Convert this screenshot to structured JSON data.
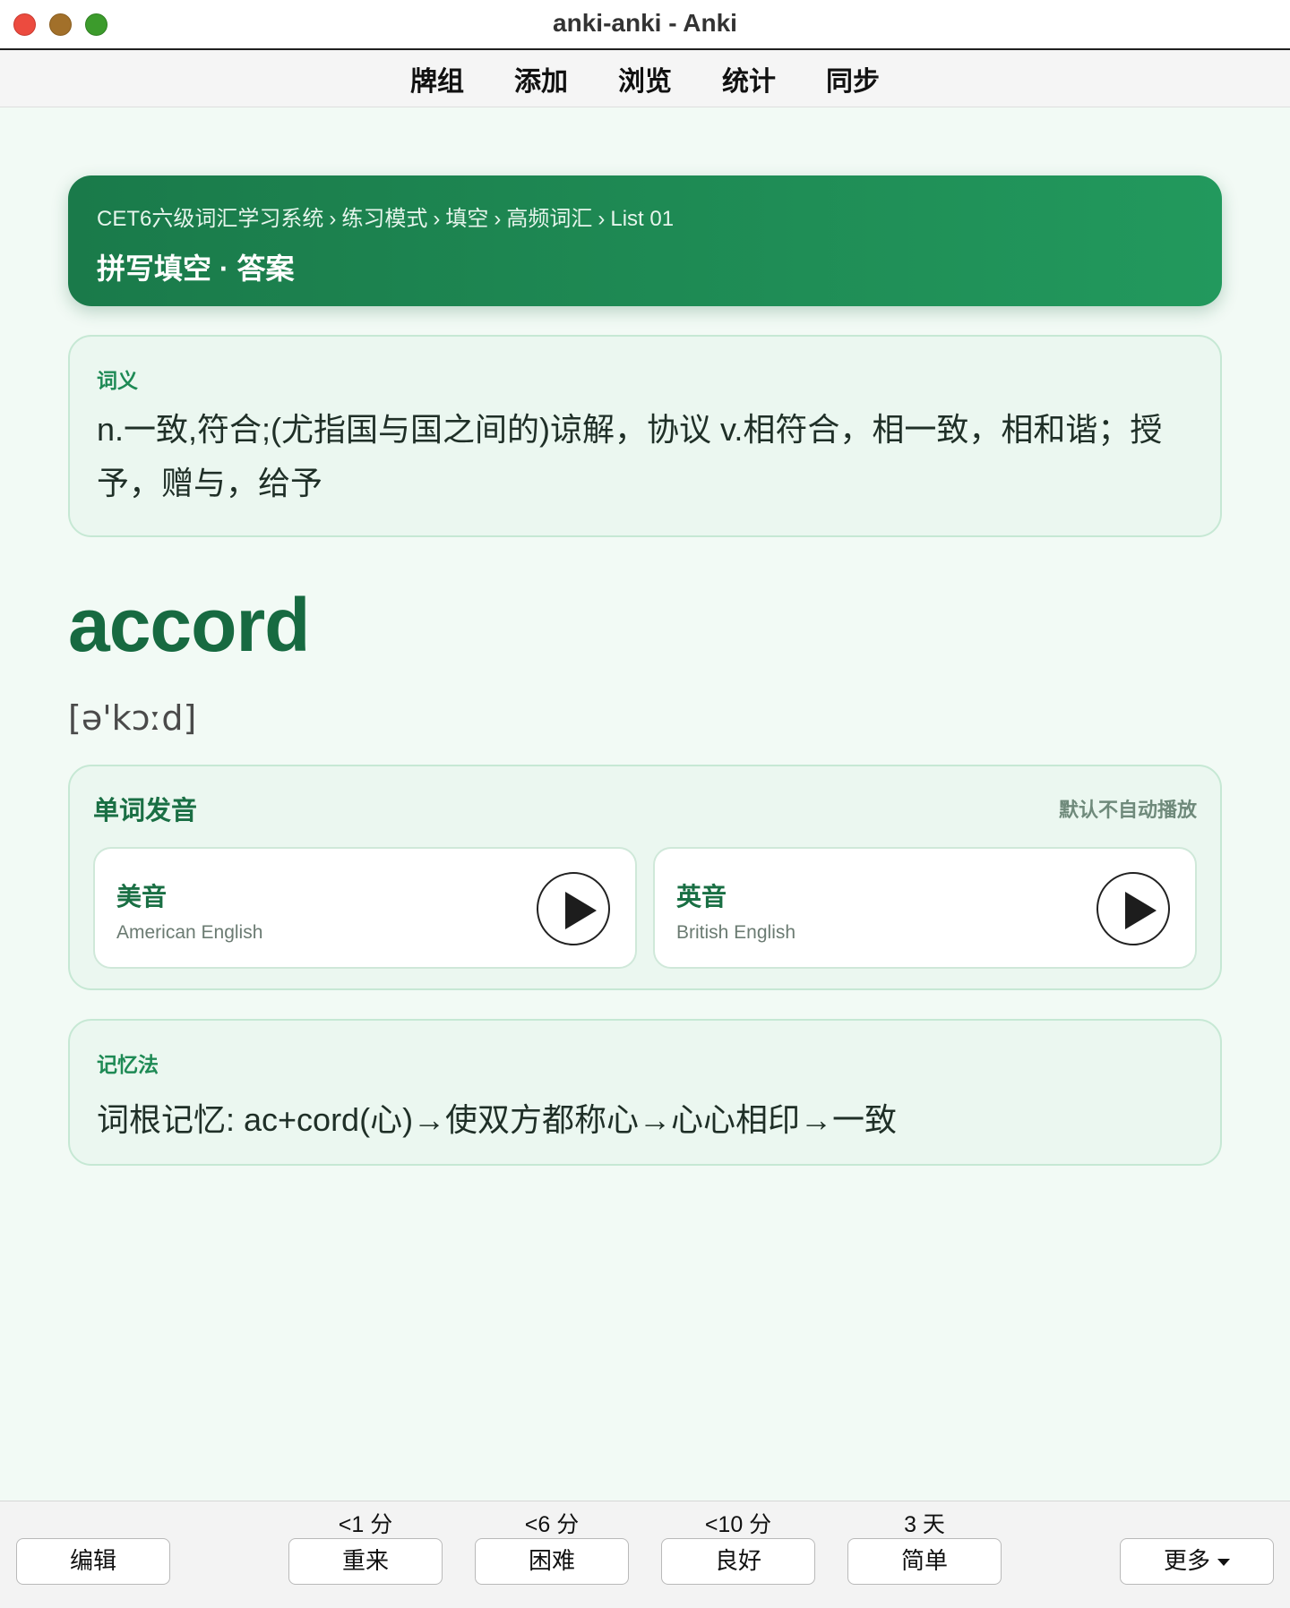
{
  "window": {
    "title": "anki-anki - Anki"
  },
  "topmenu": {
    "items": [
      "牌组",
      "添加",
      "浏览",
      "统计",
      "同步"
    ]
  },
  "header": {
    "breadcrumb": [
      "CET6六级词汇学习系统",
      "练习模式",
      "填空",
      "高频词汇",
      "List 01"
    ],
    "separator": "›",
    "title": "拼写填空 · 答案"
  },
  "meaning": {
    "label": "词义",
    "text": "n.一致,符合;(尤指国与国之间的)谅解，协议 v.相符合，相一致，相和谐；授予，赠与，给予"
  },
  "word": {
    "text": "accord",
    "phonetic": "[ə'kɔːd]"
  },
  "audio": {
    "title": "单词发音",
    "note": "默认不自动播放",
    "items": [
      {
        "name": "美音",
        "sub": "American English",
        "icon": "play-icon"
      },
      {
        "name": "英音",
        "sub": "British English",
        "icon": "play-icon"
      }
    ]
  },
  "memory": {
    "label": "记忆法",
    "text": "词根记忆: ac+cord(心)→使双方都称心→心心相印→一致"
  },
  "bottombar": {
    "edit": "编辑",
    "answers": [
      {
        "interval": "<1 分",
        "label": "重来"
      },
      {
        "interval": "<6 分",
        "label": "困难"
      },
      {
        "interval": "<10 分",
        "label": "良好"
      },
      {
        "interval": "3 天",
        "label": "简单"
      }
    ],
    "more": "更多"
  },
  "colors": {
    "accent": "#1a7a4a",
    "accent_light": "#22995d",
    "word": "#176a41",
    "card_bg": "#ebf7f0",
    "page_bg": "#f2faf5"
  }
}
